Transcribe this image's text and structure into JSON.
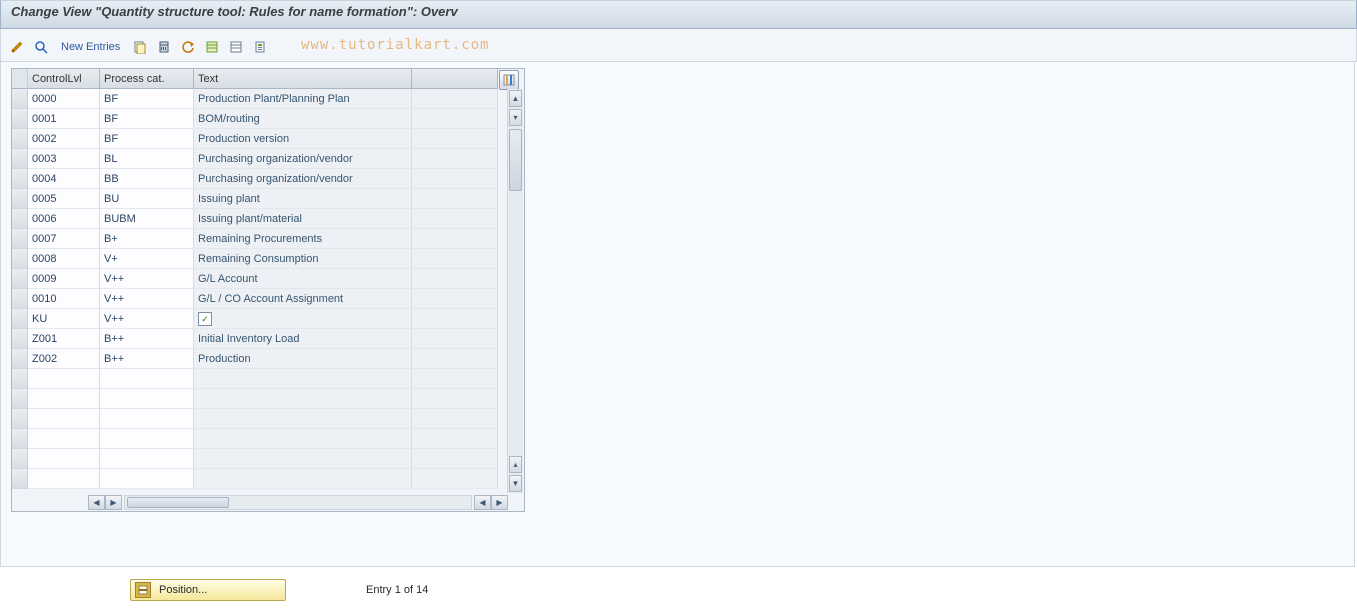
{
  "title": "Change View \"Quantity structure tool: Rules for name formation\": Overv",
  "toolbar": {
    "new_entries": "New Entries"
  },
  "watermark": "www.tutorialkart.com",
  "table": {
    "headers": {
      "control_level": "ControlLvl",
      "process_cat": "Process cat.",
      "text": "Text"
    },
    "rows": [
      {
        "control": "0000",
        "proc": "BF",
        "text": "Production Plant/Planning Plan"
      },
      {
        "control": "0001",
        "proc": "BF",
        "text": "BOM/routing"
      },
      {
        "control": "0002",
        "proc": "BF",
        "text": "Production version"
      },
      {
        "control": "0003",
        "proc": "BL",
        "text": "Purchasing organization/vendor"
      },
      {
        "control": "0004",
        "proc": "BB",
        "text": "Purchasing organization/vendor"
      },
      {
        "control": "0005",
        "proc": "BU",
        "text": "Issuing plant"
      },
      {
        "control": "0006",
        "proc": "BUBM",
        "text": "Issuing plant/material"
      },
      {
        "control": "0007",
        "proc": "B+",
        "text": "Remaining Procurements"
      },
      {
        "control": "0008",
        "proc": "V+",
        "text": "Remaining Consumption"
      },
      {
        "control": "0009",
        "proc": "V++",
        "text": "G/L Account"
      },
      {
        "control": "0010",
        "proc": "V++",
        "text": "G/L / CO Account Assignment"
      },
      {
        "control": "KU",
        "proc": "V++",
        "text": "",
        "check": true
      },
      {
        "control": "Z001",
        "proc": "B++",
        "text": "Initial Inventory Load"
      },
      {
        "control": "Z002",
        "proc": "B++",
        "text": "Production"
      }
    ],
    "empty_rows": 6
  },
  "footer": {
    "position_btn": "Position...",
    "status": "Entry 1 of 14"
  }
}
